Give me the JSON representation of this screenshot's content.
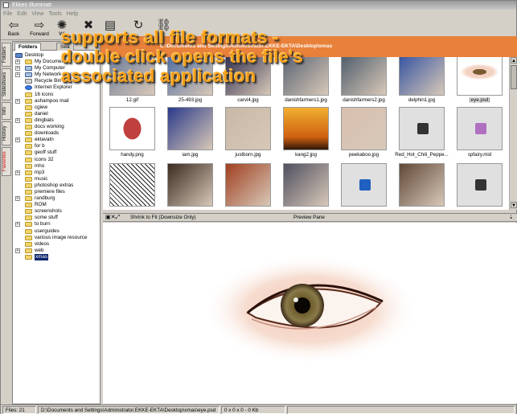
{
  "window": {
    "title": "Ekkes Illuminatr"
  },
  "menu": [
    "File",
    "Edit",
    "View",
    "Tools",
    "Help"
  ],
  "toolbar": [
    {
      "label": "Back",
      "icon": "back-arrow-icon",
      "glyph": "⇦"
    },
    {
      "label": "Forward",
      "icon": "forward-arrow-icon",
      "glyph": "⇨"
    },
    {
      "label": "Wi",
      "icon": "wizard-gear-icon",
      "glyph": "✺"
    },
    {
      "label": "",
      "icon": "tools-icon",
      "glyph": "✖"
    },
    {
      "label": "",
      "icon": "print-icon",
      "glyph": "▤"
    },
    {
      "label": "",
      "icon": "refresh-icon",
      "glyph": "↻"
    },
    {
      "label": "",
      "icon": "link-icon",
      "glyph": "⛓"
    }
  ],
  "banner": {
    "title": "C:\\Documents and Settings\\Administrator.EKKE-EKTA\\Desktop\\xmas",
    "color": "#e8813a"
  },
  "overlay": {
    "lines": [
      "supports all file formats -",
      "double click opens the file's",
      "associated application"
    ],
    "color": "#f6a01a"
  },
  "side_tabs": [
    "Folders",
    "Slideshows",
    "Info",
    "History",
    "Favorites"
  ],
  "folders_panel": {
    "tabs": [
      "Folders",
      "Sea"
    ]
  },
  "tree": [
    {
      "label": "Desktop",
      "level": 0,
      "expand": "",
      "type": "desktop"
    },
    {
      "label": "My Documents",
      "level": 1,
      "expand": "+",
      "type": "folder"
    },
    {
      "label": "My Computer",
      "level": 1,
      "expand": "+",
      "type": "computer"
    },
    {
      "label": "My Network Places",
      "level": 1,
      "expand": "+",
      "type": "network"
    },
    {
      "label": "Recycle Bin",
      "level": 1,
      "expand": "",
      "type": "recycle"
    },
    {
      "label": "Internet Explorer",
      "level": 1,
      "expand": "",
      "type": "ie"
    },
    {
      "label": "16 icons",
      "level": 1,
      "expand": "",
      "type": "folder"
    },
    {
      "label": "ashampoo mail",
      "level": 1,
      "expand": "+",
      "type": "folder"
    },
    {
      "label": "cgiew",
      "level": 1,
      "expand": "",
      "type": "folder"
    },
    {
      "label": "daniel",
      "level": 1,
      "expand": "",
      "type": "folder"
    },
    {
      "label": "dingbats",
      "level": 1,
      "expand": "+",
      "type": "folder"
    },
    {
      "label": "docs working",
      "level": 1,
      "expand": "",
      "type": "folder"
    },
    {
      "label": "downloads",
      "level": 1,
      "expand": "",
      "type": "folder"
    },
    {
      "label": "ektavatn",
      "level": 1,
      "expand": "+",
      "type": "folder"
    },
    {
      "label": "for b",
      "level": 1,
      "expand": "",
      "type": "folder"
    },
    {
      "label": "geoff stuff",
      "level": 1,
      "expand": "",
      "type": "folder"
    },
    {
      "label": "icons 32",
      "level": 1,
      "expand": "",
      "type": "folder"
    },
    {
      "label": "mho",
      "level": 1,
      "expand": "",
      "type": "folder"
    },
    {
      "label": "mp3",
      "level": 1,
      "expand": "+",
      "type": "folder"
    },
    {
      "label": "music",
      "level": 1,
      "expand": "",
      "type": "folder"
    },
    {
      "label": "photoshop extras",
      "level": 1,
      "expand": "",
      "type": "folder"
    },
    {
      "label": "premiere files",
      "level": 1,
      "expand": "",
      "type": "folder"
    },
    {
      "label": "randburg",
      "level": 1,
      "expand": "+",
      "type": "folder"
    },
    {
      "label": "ROM",
      "level": 1,
      "expand": "",
      "type": "folder"
    },
    {
      "label": "screenshots",
      "level": 1,
      "expand": "",
      "type": "folder"
    },
    {
      "label": "some stuff",
      "level": 1,
      "expand": "",
      "type": "folder"
    },
    {
      "label": "to burn",
      "level": 1,
      "expand": "+",
      "type": "folder"
    },
    {
      "label": "userguides",
      "level": 1,
      "expand": "",
      "type": "folder"
    },
    {
      "label": "various image resource",
      "level": 1,
      "expand": "",
      "type": "folder"
    },
    {
      "label": "videos",
      "level": 1,
      "expand": "",
      "type": "folder"
    },
    {
      "label": "web",
      "level": 1,
      "expand": "+",
      "type": "folder"
    },
    {
      "label": "xmas",
      "level": 1,
      "expand": "",
      "type": "folder",
      "selected": true
    }
  ],
  "thumbnails": [
    {
      "caption": "12.gif",
      "kind": "image",
      "fill": "#6a7a9a"
    },
    {
      "caption": "25-493.jpg",
      "kind": "image",
      "fill": "#4a6aa0"
    },
    {
      "caption": "carvi4.jpg",
      "kind": "image",
      "fill": "#2a2a4a"
    },
    {
      "caption": "danishfarmers1.jpg",
      "kind": "image",
      "fill": "#556070"
    },
    {
      "caption": "danishfarmers2.jpg",
      "kind": "image",
      "fill": "#4a5a6a"
    },
    {
      "caption": "delphin1.jpg",
      "kind": "image",
      "fill": "#3050a0"
    },
    {
      "caption": "eye.psd",
      "kind": "eye",
      "fill": "#ffffff",
      "selected": true
    },
    {
      "caption": "handy.png",
      "kind": "hand",
      "fill": "#ffffff"
    },
    {
      "caption": "iam.jpg",
      "kind": "image",
      "fill": "#2a3a8a"
    },
    {
      "caption": "justborn.jpg",
      "kind": "image",
      "fill": "#c8b8a8"
    },
    {
      "caption": "kang2.jpg",
      "kind": "sunset",
      "fill": "#e89020"
    },
    {
      "caption": "peekaboo.jpg",
      "kind": "image",
      "fill": "#d8c0b0"
    },
    {
      "caption": "Red_Hot_Chili_Peppe...",
      "kind": "file",
      "fill": "#e0e0e0",
      "icon": "media-file-icon",
      "icon_color": "#333333"
    },
    {
      "caption": "spfairy.mid",
      "kind": "file",
      "fill": "#e0e0e0",
      "icon": "midi-file-icon",
      "icon_color": "#b070c0"
    },
    {
      "caption": "",
      "kind": "sketch",
      "fill": "#ffffff"
    },
    {
      "caption": "",
      "kind": "image",
      "fill": "#3a2a20"
    },
    {
      "caption": "",
      "kind": "image",
      "fill": "#a04020"
    },
    {
      "caption": "",
      "kind": "image",
      "fill": "#505060"
    },
    {
      "caption": "",
      "kind": "file",
      "fill": "#e0e0e0",
      "icon": "ie-file-icon",
      "icon_color": "#2060c0"
    },
    {
      "caption": "",
      "kind": "image",
      "fill": "#604838"
    },
    {
      "caption": "",
      "kind": "file",
      "fill": "#e0e0e0",
      "icon": "media-file-icon",
      "icon_color": "#333333"
    }
  ],
  "preview_bar": {
    "shrink_label": "Shrink to Fit (Downsize Only)",
    "title": "Preview Pane",
    "pin": "⇣"
  },
  "status": {
    "files": "Files: 21",
    "path": "D:\\Documents and Settings\\Administrator.EKKE-EKTA\\Desktop\\xmas\\eye.psd",
    "dims": "0 x 0 x 0 - 0 Kb"
  }
}
